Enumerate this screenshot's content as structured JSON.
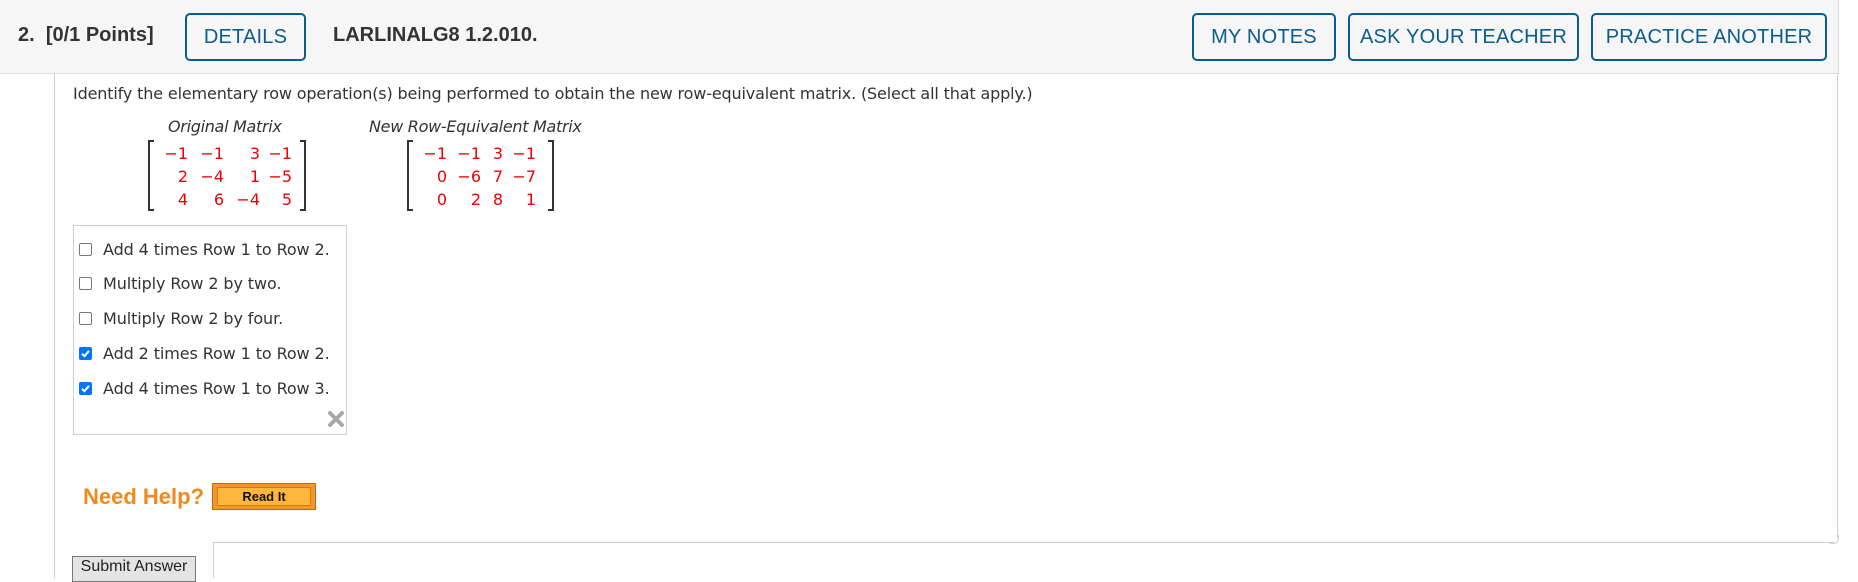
{
  "header": {
    "question_number": "2.",
    "points": "[0/1 Points]",
    "details_label": "DETAILS",
    "question_code": "LARLINALG8 1.2.010.",
    "my_notes_label": "MY NOTES",
    "ask_teacher_label": "ASK YOUR TEACHER",
    "practice_another_label": "PRACTICE ANOTHER"
  },
  "question": {
    "prompt": "Identify the elementary row operation(s) being performed to obtain the new row-equivalent matrix. (Select all that apply.)",
    "original_label": "Original Matrix",
    "new_label": "New Row-Equivalent Matrix",
    "original_matrix": [
      [
        "−1",
        "−1",
        "3",
        "−1"
      ],
      [
        "2",
        "−4",
        "1",
        "−5"
      ],
      [
        "4",
        "6",
        "−4",
        "5"
      ]
    ],
    "new_matrix": [
      [
        "−1",
        "−1",
        "3",
        "−1"
      ],
      [
        "0",
        "−6",
        "7",
        "−7"
      ],
      [
        "0",
        "2",
        "8",
        "1"
      ]
    ]
  },
  "options": [
    {
      "label": "Add 4 times Row 1 to Row 2.",
      "checked": false
    },
    {
      "label": "Multiply Row 2 by two.",
      "checked": false
    },
    {
      "label": "Multiply Row 2 by four.",
      "checked": false
    },
    {
      "label": "Add 2 times Row 1 to Row 2.",
      "checked": true
    },
    {
      "label": "Add 4 times Row 1 to Row 3.",
      "checked": true
    }
  ],
  "help": {
    "need_help_label": "Need Help?",
    "read_it_label": "Read It"
  },
  "submit_label": "Submit Answer",
  "colors": {
    "accent": "#0b5c8f",
    "matrix_entry": "#ee0000",
    "help_orange": "#f08a1c",
    "checkbox_checked": "#0075ff"
  }
}
